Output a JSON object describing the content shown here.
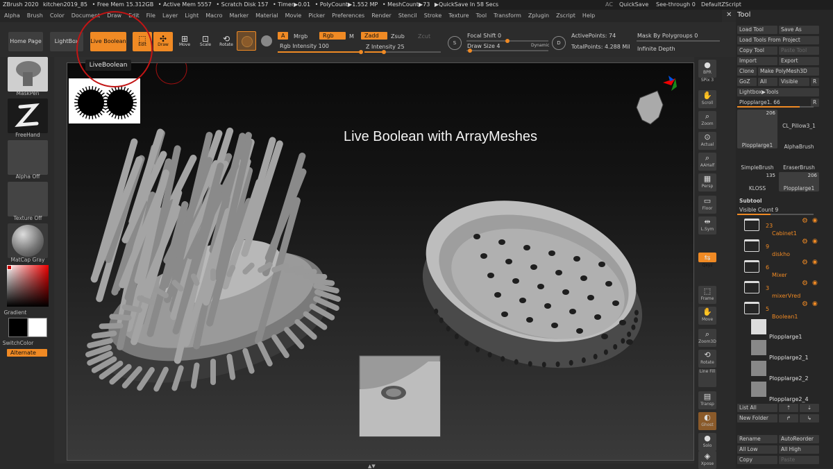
{
  "app": {
    "title": "ZBrush 2020",
    "file": "kitchen2019_85",
    "free_mem": "• Free Mem 15.312GB",
    "active_mem": "• Active Mem 5557",
    "scratch": "• Scratch Disk 157",
    "timer": "• Timer▶0.01",
    "polycount": "• PolyCount▶1.552 MP",
    "meshcount": "• MeshCount▶73",
    "quicksave": "▶QuickSave In 58 Secs",
    "ac": "AC",
    "quicksave_btn": "QuickSave",
    "seethrough": "See-through  0",
    "script": "DefaultZScript"
  },
  "menu": [
    "Alpha",
    "Brush",
    "Color",
    "Document",
    "Draw",
    "Edit",
    "File",
    "Layer",
    "Light",
    "Macro",
    "Marker",
    "Material",
    "Movie",
    "Picker",
    "Preferences",
    "Render",
    "Stencil",
    "Stroke",
    "Texture",
    "Tool",
    "Transform",
    "Zplugin",
    "Zscript",
    "Help"
  ],
  "toolbar": {
    "home_page": "Home Page",
    "lightbox": "LightBox",
    "live_boolean": "Live Boolean",
    "tooltip": "LiveBoolean",
    "edit": "Edit",
    "draw": "Draw",
    "move": "Move",
    "scale": "Scale",
    "rotate": "Rotate",
    "a": "A",
    "mrgb": "Mrgb",
    "rgb": "Rgb",
    "m": "M",
    "zadd": "Zadd",
    "zsub": "Zsub",
    "zcut": "Zcut",
    "rgb_intensity": "Rgb Intensity 100",
    "z_intensity": "Z Intensity 25",
    "focal_shift": "Focal Shift 0",
    "draw_size": "Draw Size 4",
    "dynamic": "Dynamic",
    "active_points": "ActivePoints: 74",
    "total_points": "TotalPoints: 4.288 Mil",
    "mask_polygroups": "Mask By Polygroups 0",
    "infinite_depth": "Infinite Depth",
    "s": "S",
    "d": "D",
    "rgb_level": 1.0,
    "z_level": 0.25
  },
  "left_shelf": {
    "maskpen": "MaskPen",
    "freehand": "FreeHand",
    "alpha_off": "Alpha Off",
    "texture_off": "Texture Off",
    "matcap": "MatCap Gray",
    "gradient": "Gradient",
    "switchcolor": "SwitchColor",
    "alternate": "Alternate"
  },
  "viewport": {
    "caption": "Live Boolean with ArrayMeshes"
  },
  "right_shelf": {
    "bpr": "BPR",
    "spix": "SPix 3",
    "scroll": "Scroll",
    "zoom": "Zoom",
    "actual": "Actual",
    "aahalf": "AAHalf",
    "dynamic": "Dynamic",
    "persp": "Persp",
    "floor": "Floor",
    "lsym": "L.Sym",
    "qxyz": "Qxyz",
    "frame": "Frame",
    "move": "Move",
    "zoom3d": "Zoom3D",
    "rotate": "Rotate",
    "linefill": "Line Fill",
    "polyf": "PolyF",
    "transp": "Transp",
    "ghost": "Ghost",
    "dynamic2": "Dynamic",
    "solo": "Solo",
    "xpose": "Xpose"
  },
  "tool_panel": {
    "title": "Tool",
    "load_tool": "Load Tool",
    "save_as": "Save As",
    "load_from_project": "Load Tools From Project",
    "copy_tool": "Copy Tool",
    "paste_tool": "Paste Tool",
    "import": "Import",
    "export": "Export",
    "clone": "Clone",
    "make_polymesh": "Make PolyMesh3D",
    "goz": "GoZ",
    "all": "All",
    "visible": "Visible",
    "r": "R",
    "lightbox_tools": "Lightbox▶Tools",
    "current_tool": "Plopplarge1. 66",
    "r2": "R",
    "thumbs": [
      {
        "name": "Plopplarge1",
        "count": "206"
      },
      {
        "name": "CL_Pillow3_1",
        "count": ""
      },
      {
        "name": "AlphaBrush",
        "count": ""
      },
      {
        "name": "SimpleBrush",
        "count": ""
      },
      {
        "name": "EraserBrush",
        "count": ""
      },
      {
        "name": "KLOSS",
        "count": "135"
      },
      {
        "name": "Plopplarge1",
        "count": "206"
      }
    ],
    "subtool": "Subtool",
    "visible_count": "Visible Count 9",
    "subtools": [
      {
        "num": "23",
        "name": "Cabinet1"
      },
      {
        "num": "9",
        "name": "diskho"
      },
      {
        "num": "6",
        "name": "Mixer"
      },
      {
        "num": "3",
        "name": "mixerVred"
      },
      {
        "num": "5",
        "name": "Boolean1"
      }
    ],
    "children": [
      "Plopplarge1",
      "Plopplarge2_1",
      "Plopplarge2_2",
      "Plopplarge2_4"
    ],
    "list_all": "List All",
    "new_folder": "New Folder",
    "rename": "Rename",
    "autoreorder": "AutoReorder",
    "all_low": "All Low",
    "all_high": "All High",
    "copy": "Copy",
    "paste": "Paste"
  }
}
